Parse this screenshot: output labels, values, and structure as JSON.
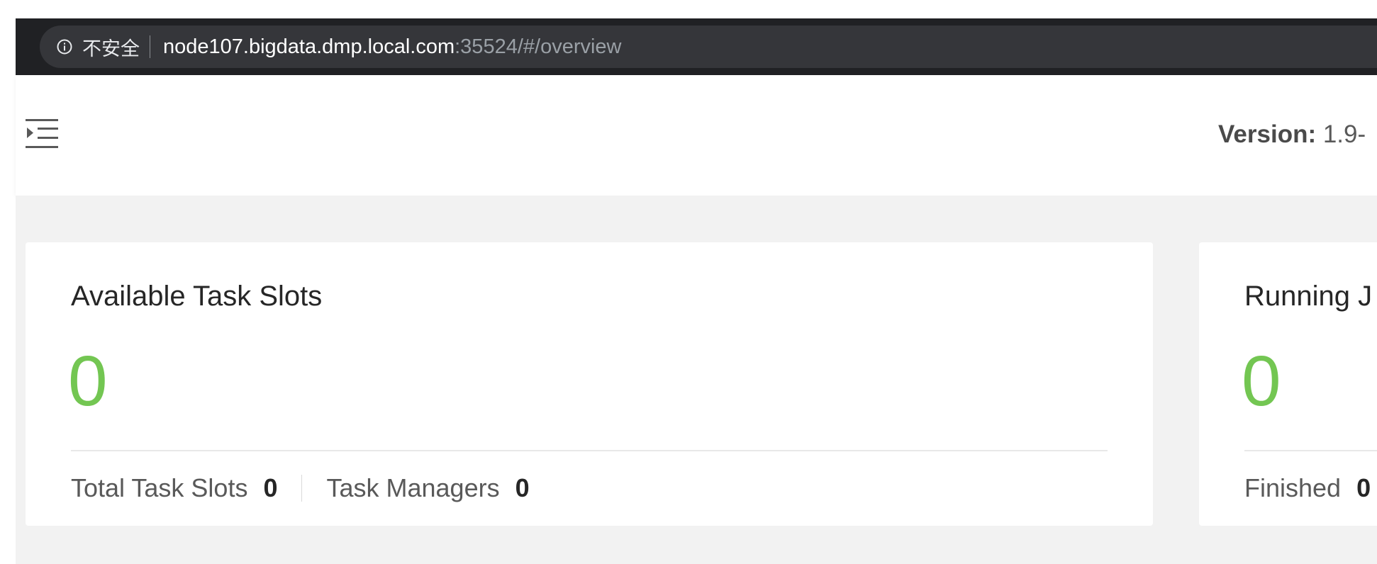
{
  "browser": {
    "security_label": "不安全",
    "url_host": "node107.bigdata.dmp.local.com",
    "url_rest": ":35524/#/overview"
  },
  "header": {
    "version_label": "Version:",
    "version_value": "1.9-"
  },
  "cards": {
    "task_slots": {
      "title": "Available Task Slots",
      "value": "0",
      "total_label": "Total Task Slots",
      "total_value": "0",
      "tm_label": "Task Managers",
      "tm_value": "0"
    },
    "running_jobs": {
      "title": "Running J",
      "value": "0",
      "finished_label": "Finished",
      "finished_value": "0"
    }
  },
  "colors": {
    "accent_green": "#73c652",
    "browser_bar": "#202124",
    "omnibox": "#35363a",
    "page_bg": "#f2f2f2"
  },
  "icons": {
    "info": "info-circle-icon",
    "menu": "menu-indent-icon"
  }
}
